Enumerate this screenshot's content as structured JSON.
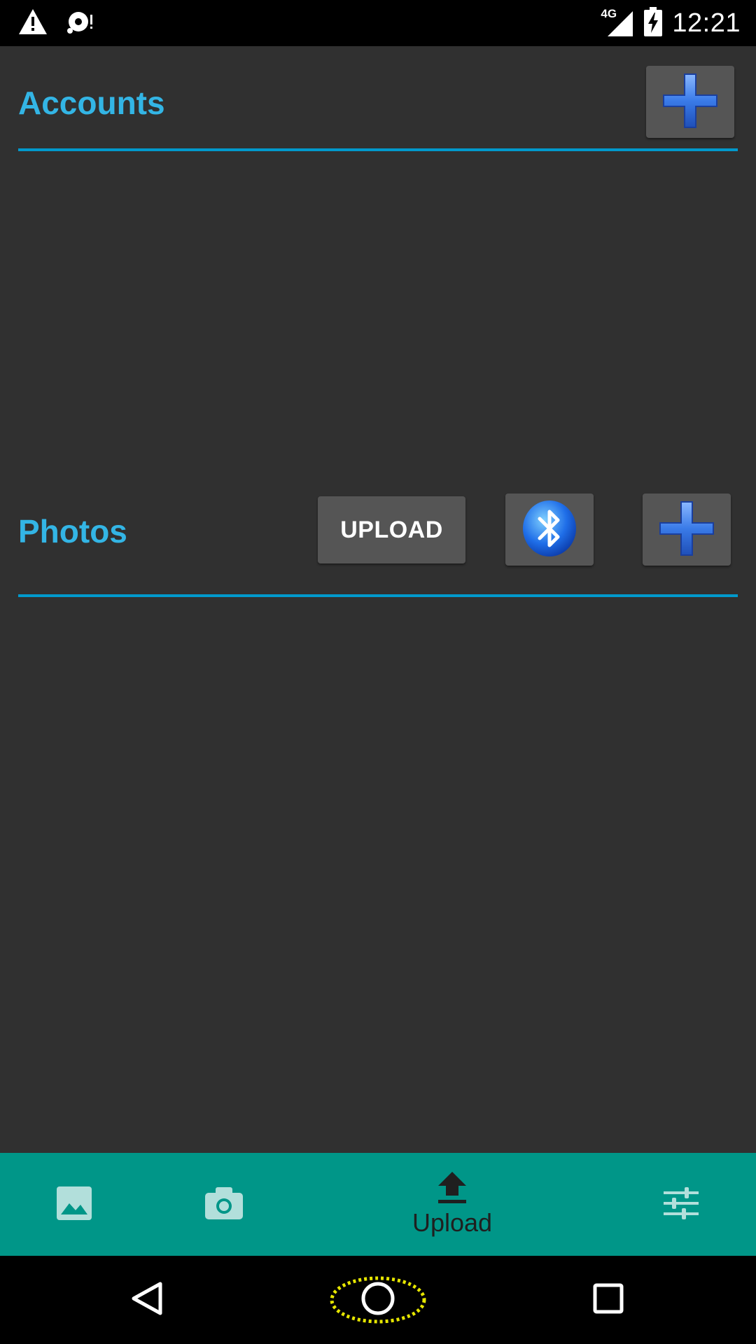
{
  "status_bar": {
    "time": "12:21",
    "network": "4G",
    "icons": [
      "warning-icon",
      "sync-problem-icon",
      "signal-icon",
      "battery-charging-icon"
    ]
  },
  "accounts": {
    "title": "Accounts",
    "add_icon": "plus-icon"
  },
  "photos": {
    "title": "Photos",
    "upload_label": "UPLOAD",
    "bluetooth_icon": "bluetooth-icon",
    "add_icon": "plus-icon"
  },
  "bottom_nav": {
    "items": [
      {
        "icon": "image-icon",
        "label": ""
      },
      {
        "icon": "camera-icon",
        "label": ""
      },
      {
        "icon": "upload-icon",
        "label": "Upload",
        "active": true
      },
      {
        "icon": "tune-icon",
        "label": ""
      }
    ]
  },
  "system_nav": {
    "icons": [
      "back-icon",
      "home-icon",
      "recents-icon"
    ]
  },
  "colors": {
    "accent": "#33b5e5",
    "divider": "#0099cc",
    "background": "#303030",
    "button": "#555555",
    "bottom_nav": "#009688"
  }
}
